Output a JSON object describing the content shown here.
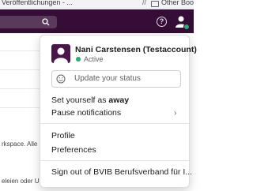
{
  "browser": {
    "bookmark_left": "Veröffentlichungen - ...",
    "separator": "//",
    "bookmark_right": "Other Bookmarks"
  },
  "background": {
    "text_a": "rkspace. Alle",
    "text_b": "eleien oder U"
  },
  "topbar": {
    "help_glyph": "?"
  },
  "menu": {
    "user_name": "Nani Carstensen (Testaccount)",
    "status_text": "Active",
    "status_placeholder": "Update your status",
    "set_away_prefix": "Set yourself as ",
    "set_away_bold": "away",
    "pause_notifications": "Pause notifications",
    "chevron": "›",
    "profile": "Profile",
    "preferences": "Preferences",
    "sign_out": "Sign out of BVIB Berufsverband für I..."
  },
  "colors": {
    "topbar": "#350d36",
    "active_green": "#2bac76",
    "avatar_purple": "#4a154b"
  }
}
